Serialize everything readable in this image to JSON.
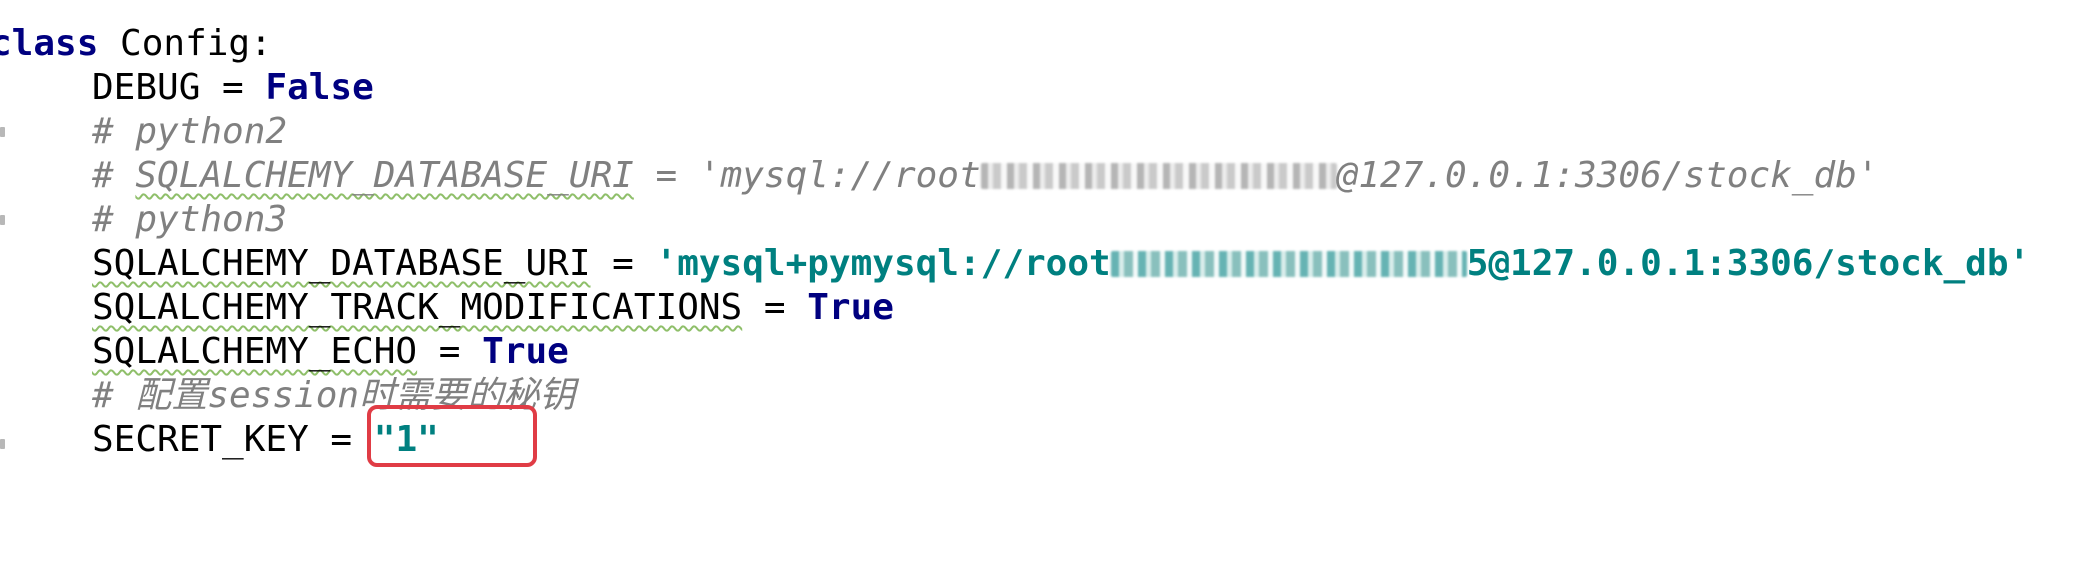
{
  "code": {
    "line1": {
      "keyword": "class",
      "rest": " Config:"
    },
    "line2": {
      "name": "DEBUG = ",
      "value": "False"
    },
    "line3": {
      "comment": "# python2"
    },
    "line4": {
      "comment_prefix": "# ",
      "comment_var": "SQLALCHEMY_DATABASE_URI",
      "comment_mid": " = 'mysql://root",
      "comment_after_redaction": "@127.0.0.1:3306/stock_db'"
    },
    "line5": {
      "comment": "# python3"
    },
    "line6": {
      "name": "SQLALCHEMY_DATABASE_URI",
      "op": " = ",
      "string_start": "'mysql+pymysql://root",
      "string_end": "5@127.0.0.1:3306/stock_db'"
    },
    "line7": {
      "name": "SQLALCHEMY_TRACK_MODIFICATIONS",
      "op": " = ",
      "value": "True"
    },
    "line8": {
      "name": "SQLALCHEMY_ECHO",
      "op": " = ",
      "value": "True"
    },
    "line9": {
      "comment": "# 配置session时需要的秘钥"
    },
    "line10": {
      "name": "SECRET_KEY = ",
      "value": "\"1\""
    }
  },
  "colors": {
    "keyword": "#000080",
    "comment": "#808080",
    "string": "#008080",
    "highlight_box": "#e03c45"
  }
}
